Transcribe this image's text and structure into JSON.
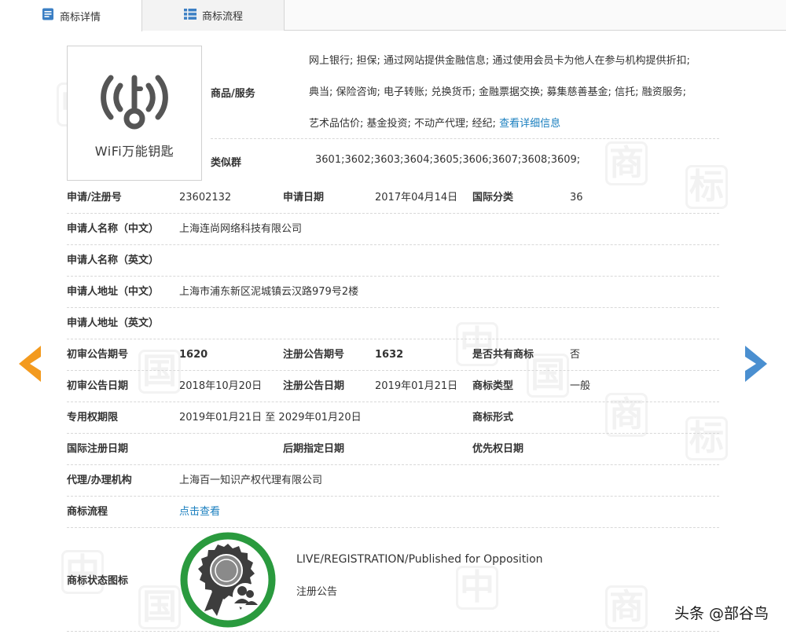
{
  "tabs": [
    {
      "label": "商标详情",
      "active": true
    },
    {
      "label": "商标流程",
      "active": false
    }
  ],
  "logo": {
    "text": "WiFi万能钥匙"
  },
  "goods": {
    "label": "商品/服务",
    "lines": [
      "网上银行; 担保; 通过网站提供金融信息; 通过使用会员卡为他人在参与机构提供折扣;",
      "典当; 保险咨询; 电子转账; 兑换货币; 金融票据交换; 募集慈善基金; 信托; 融资服务;",
      "艺术品估价; 基金投资; 不动产代理; 经纪; "
    ],
    "more_link": "查看详细信息"
  },
  "similar": {
    "label": "类似群",
    "value": "3601;3602;3603;3604;3605;3606;3607;3608;3609;"
  },
  "fields": {
    "reg_no_label": "申请/注册号",
    "reg_no": "23602132",
    "apply_date_label": "申请日期",
    "apply_date": "2017年04月14日",
    "intl_class_label": "国际分类",
    "intl_class": "36",
    "applicant_cn_label": "申请人名称（中文）",
    "applicant_cn": "上海连尚网络科技有限公司",
    "applicant_en_label": "申请人名称（英文）",
    "applicant_en": "",
    "address_cn_label": "申请人地址（中文）",
    "address_cn": "上海市浦东新区泥城镇云汉路979号2楼",
    "address_en_label": "申请人地址（英文）",
    "address_en": "",
    "prelim_no_label": "初审公告期号",
    "prelim_no": "1620",
    "reg_notice_no_label": "注册公告期号",
    "reg_notice_no": "1632",
    "shared_label": "是否共有商标",
    "shared": "否",
    "prelim_date_label": "初审公告日期",
    "prelim_date": "2018年10月20日",
    "reg_notice_date_label": "注册公告日期",
    "reg_notice_date": "2019年01月21日",
    "tm_type_label": "商标类型",
    "tm_type": "一般",
    "exclusive_label": "专用权期限",
    "exclusive": "2019年01月21日 至 2029年01月20日",
    "tm_form_label": "商标形式",
    "tm_form": "",
    "intl_reg_label": "国际注册日期",
    "intl_reg": "",
    "later_label": "后期指定日期",
    "later": "",
    "priority_label": "优先权日期",
    "priority": "",
    "agent_label": "代理/办理机构",
    "agent": "上海百一知识产权代理有限公司",
    "flow_label": "商标流程",
    "flow_link": "点击查看"
  },
  "status": {
    "label": "商标状态图标",
    "en": "LIVE/REGISTRATION/Published for Opposition",
    "cn": "注册公告"
  },
  "watermark": {
    "chars": [
      "中",
      "国",
      "商",
      "标"
    ]
  },
  "footer": {
    "text": "头条 @部谷鸟"
  },
  "colors": {
    "accent": "#1a7fbf",
    "arrow_left": "#f39a1e",
    "arrow_right": "#4a8fd0",
    "badge_ring": "#2a9a3e"
  }
}
